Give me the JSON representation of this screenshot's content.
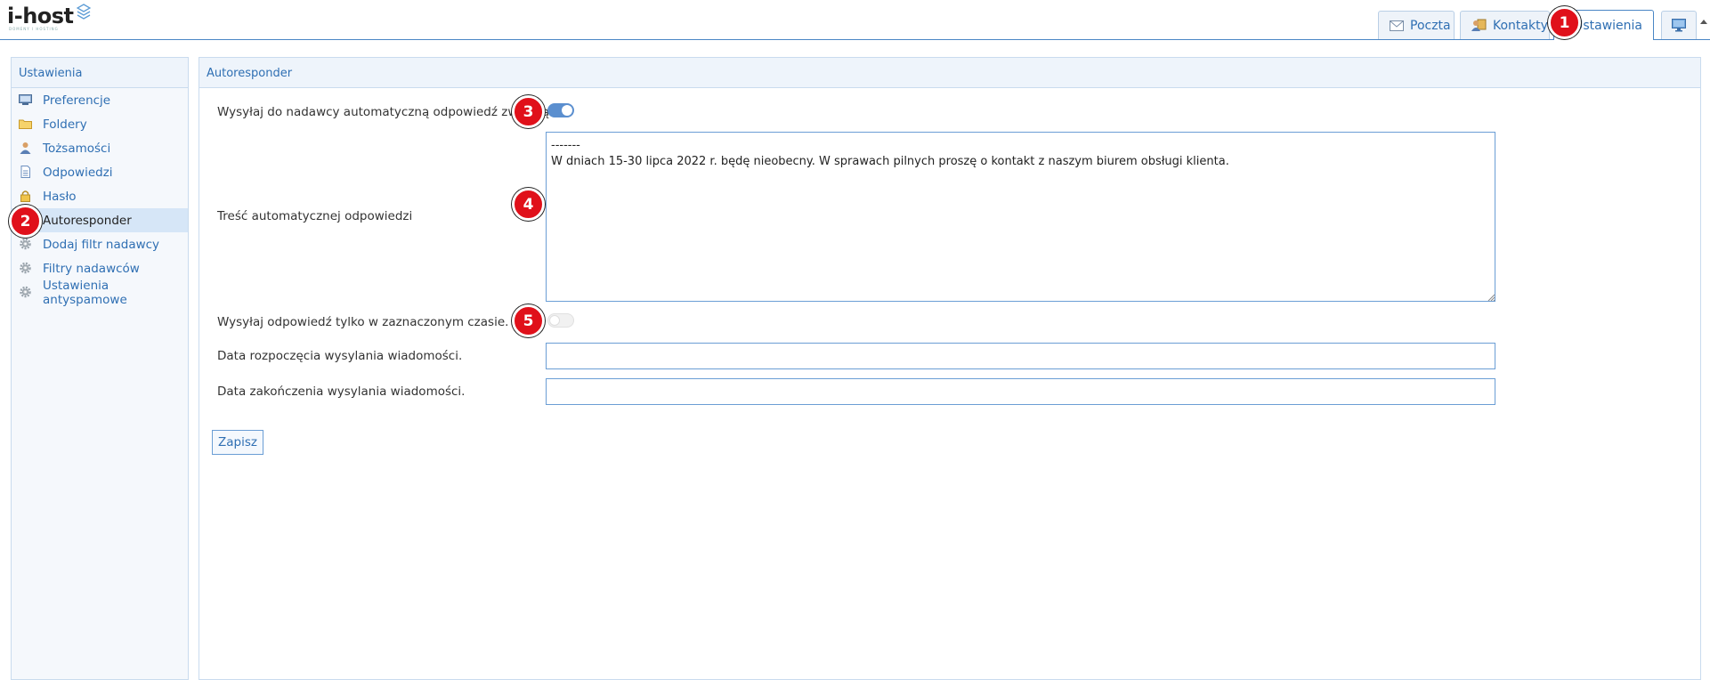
{
  "brand": {
    "name": "i-host",
    "tagline": "DOMENY I HOSTING"
  },
  "tabs": [
    {
      "label": "Poczta",
      "icon": "envelope-icon"
    },
    {
      "label": "Kontakty",
      "icon": "contacts-icon"
    },
    {
      "label": "Ustawienia",
      "icon": "settings-icon",
      "active": true
    }
  ],
  "sidebar": {
    "title": "Ustawienia",
    "items": [
      {
        "label": "Preferencje",
        "icon": "preferences-icon"
      },
      {
        "label": "Foldery",
        "icon": "folder-icon"
      },
      {
        "label": "Tożsamości",
        "icon": "identity-icon"
      },
      {
        "label": "Odpowiedzi",
        "icon": "document-icon"
      },
      {
        "label": "Hasło",
        "icon": "lock-icon"
      },
      {
        "label": "Autoresponder",
        "icon": "autoresponder-icon",
        "active": true
      },
      {
        "label": "Dodaj filtr nadawcy",
        "icon": "gear-icon"
      },
      {
        "label": "Filtry nadawców",
        "icon": "gear-icon"
      },
      {
        "label": "Ustawienia antyspamowe",
        "icon": "gear-icon"
      }
    ]
  },
  "main": {
    "title": "Autoresponder",
    "enable_label": "Wysyłaj do nadawcy automatyczną odpowiedź zwrotną",
    "enable_on": true,
    "body_label": "Treść automatycznej odpowiedzi",
    "body_text": "-------\nW dniach 15-30 lipca 2022 r. będę nieobecny. W sprawach pilnych proszę o kontakt z naszym biurem obsługi klienta.",
    "schedule_label": "Wysyłaj odpowiedź tylko w zaznaczonym czasie.",
    "schedule_on": false,
    "start_label": "Data rozpoczęcia wysylania wiadomości.",
    "start_value": "",
    "end_label": "Data zakończenia wysylania wiadomości.",
    "end_value": "",
    "save_label": "Zapisz"
  },
  "markers": [
    "1",
    "2",
    "3",
    "4",
    "5"
  ],
  "colors": {
    "accent": "#2f6fb3",
    "marker": "#e0101a",
    "toggle_on": "#5b8fcf"
  }
}
